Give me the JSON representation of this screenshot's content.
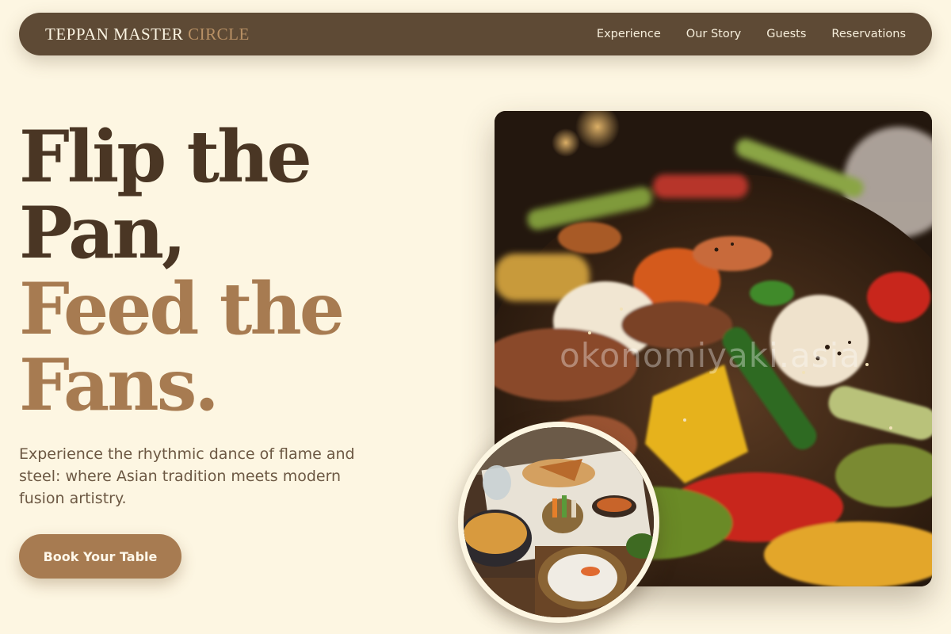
{
  "nav": {
    "logo_main": "TEPPAN MASTER",
    "logo_accent": "CIRCLE",
    "links": [
      "Experience",
      "Our Story",
      "Guests",
      "Reservations"
    ]
  },
  "hero": {
    "headline_line1": "Flip the",
    "headline_line2": "Pan,",
    "headline_line3": "Feed the",
    "headline_line4": "Fans.",
    "subtitle": "Experience the rhythmic dance of flame and steel: where Asian tradition meets modern fusion artistry.",
    "cta_label": "Book Your Table",
    "image_watermark": "okonomiyaki.asia"
  },
  "colors": {
    "background": "#fdf6e2",
    "nav_bg": "#5e4a35",
    "brand_dark": "#4a3624",
    "brand_accent": "#a77b51"
  }
}
